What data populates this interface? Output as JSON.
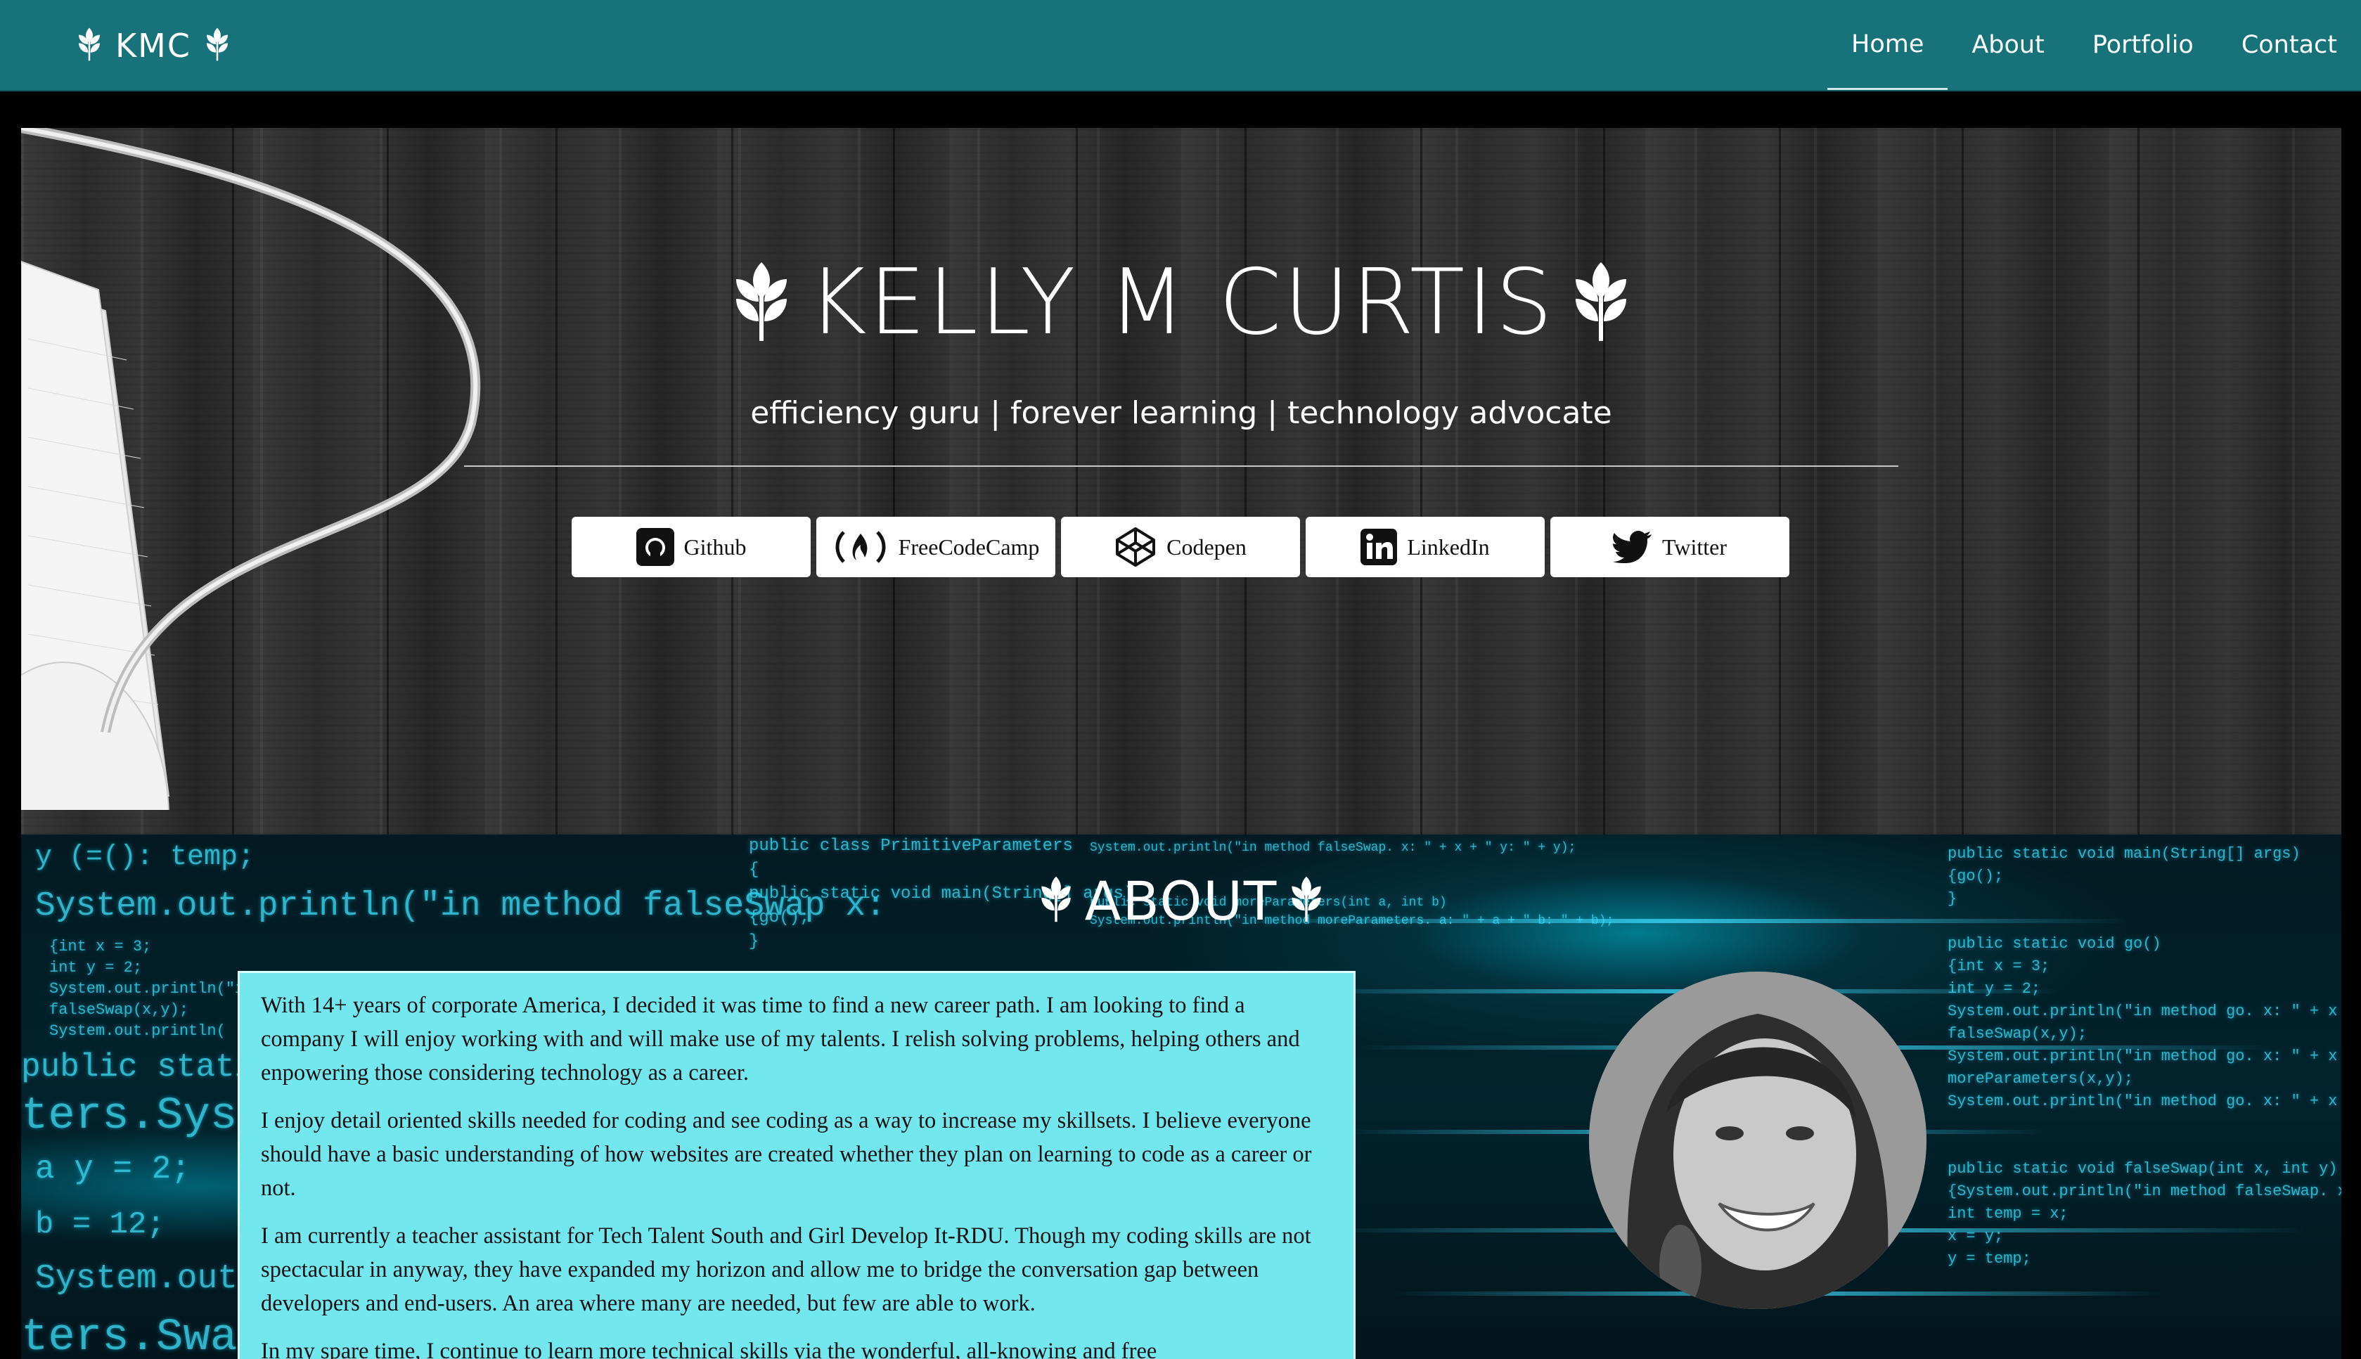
{
  "navbar": {
    "brand": "KMC",
    "links": [
      {
        "label": "Home",
        "active": true
      },
      {
        "label": "About",
        "active": false
      },
      {
        "label": "Portfolio",
        "active": false
      },
      {
        "label": "Contact",
        "active": false
      }
    ]
  },
  "hero": {
    "title": "KELLY M CURTIS",
    "tagline": "efficiency guru | forever learning | technology advocate",
    "social": [
      {
        "label": "Github",
        "icon": "github-icon"
      },
      {
        "label": "FreeCodeCamp",
        "icon": "freecodecamp-icon"
      },
      {
        "label": "Codepen",
        "icon": "codepen-icon"
      },
      {
        "label": "LinkedIn",
        "icon": "linkedin-icon"
      },
      {
        "label": "Twitter",
        "icon": "twitter-icon"
      }
    ]
  },
  "about": {
    "title": "ABOUT",
    "paragraphs": [
      "With 14+ years of corporate America, I decided it was time to find a new career path. I am looking to find a company I will enjoy working with and will make use of my talents. I relish solving problems, helping others and enpowering those considering technology as a career.",
      "I enjoy detail oriented skills needed for coding and see coding as a way to increase my skillsets. I believe everyone should have a basic understanding of how websites are created whether they plan on learning to code as a career or not.",
      "I am currently a teacher assistant for Tech Talent South and Girl Develop It-RDU. Though my coding skills are not spectacular in anyway, they have expanded my horizon and allow me to bridge the conversation gap between developers and end-users. An area where many are needed, but few are able to work.",
      "In my spare time, I continue to learn more technical skills via the wonderful, all-knowing and free"
    ]
  },
  "colors": {
    "navbar": "#17727a",
    "card": "#72e7ee",
    "code_glow": "#37cfe6"
  }
}
